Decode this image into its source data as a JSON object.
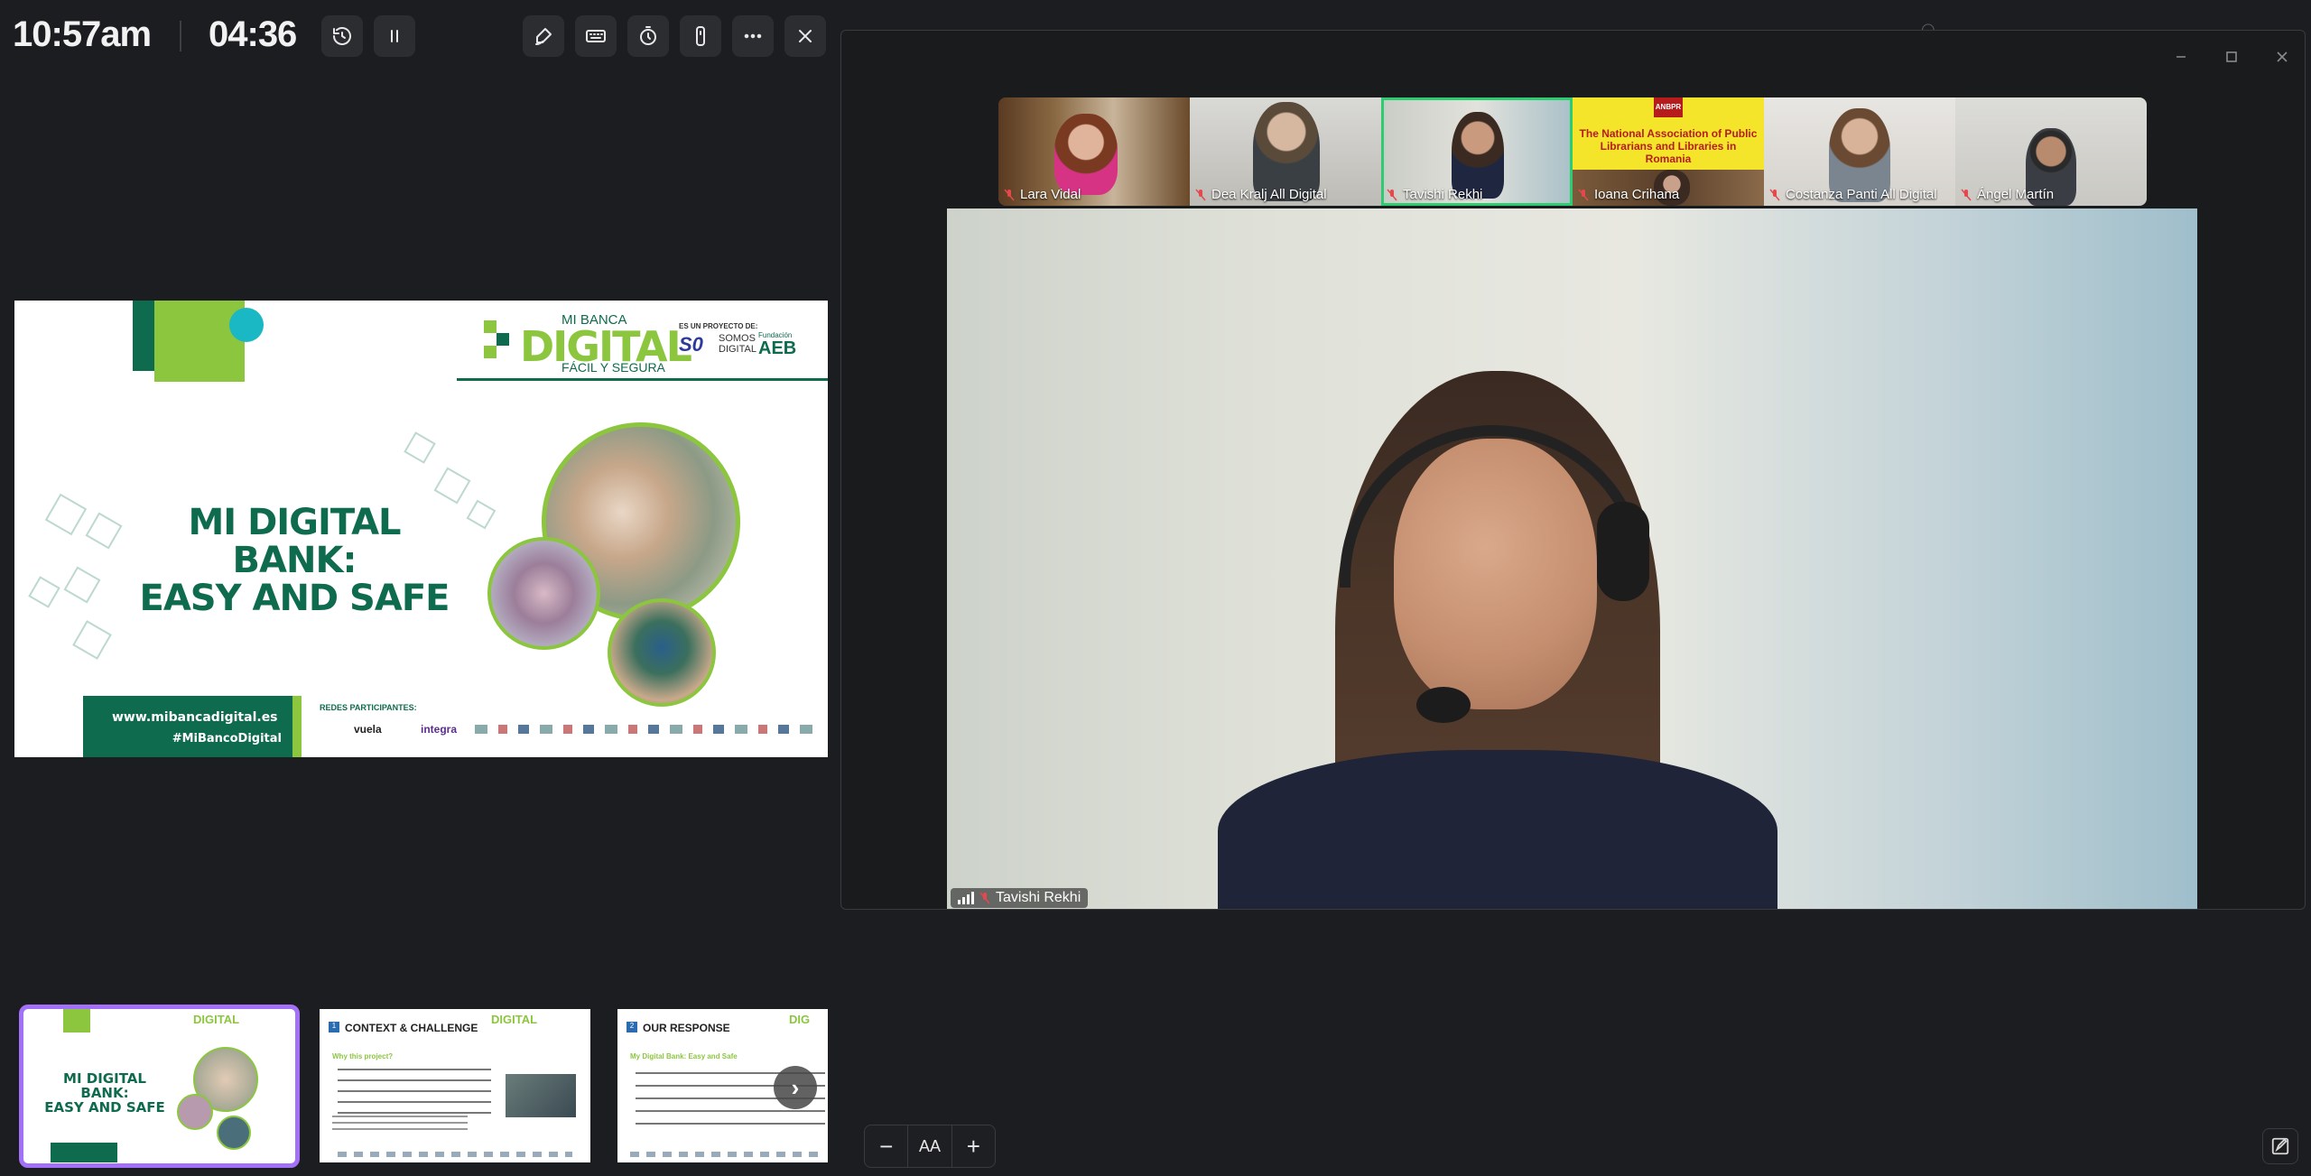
{
  "toolbar": {
    "current_time": "10:57am",
    "elapsed_time": "04:36",
    "buttons": [
      {
        "name": "restart-timer",
        "icon": "history-icon"
      },
      {
        "name": "pause",
        "icon": "pause-icon"
      },
      {
        "name": "pen",
        "icon": "pen-icon"
      },
      {
        "name": "keyboard",
        "icon": "keyboard-icon"
      },
      {
        "name": "timer",
        "icon": "stopwatch-icon"
      },
      {
        "name": "laser-pointer",
        "icon": "pointer-icon"
      },
      {
        "name": "more",
        "icon": "more-icon"
      },
      {
        "name": "close",
        "icon": "close-icon"
      }
    ]
  },
  "slide": {
    "brand_small": "MI BANCA",
    "brand_big": "DIGITAL",
    "brand_sub": "FÁCIL Y SEGURA",
    "project_label": "ES UN PROYECTO DE:",
    "partner1": "SOMOS DIGITAL",
    "partner2_small": "Fundación",
    "partner2": "AEB",
    "title_line1": "MI DIGITAL BANK:",
    "title_line2": "EASY AND SAFE",
    "url": "www.mibancadigital.es",
    "hashtag": "#MiBancoDigital",
    "networks_label": "REDES PARTICIPANTES:",
    "logos": [
      "vuela",
      "integra"
    ]
  },
  "thumbnails": [
    {
      "title_line1": "MI DIGITAL BANK:",
      "title_line2": "EASY AND SAFE"
    },
    {
      "number": "1",
      "title": "CONTEXT & CHALLENGE",
      "subtitle": "Why this project?"
    },
    {
      "number": "2",
      "title": "OUR RESPONSE",
      "subtitle": "My Digital Bank: Easy and Safe"
    }
  ],
  "participants": [
    {
      "name": "Lara Vidal"
    },
    {
      "name": "Dea Kralj All Digital"
    },
    {
      "name": "Tavishi Rekhi"
    },
    {
      "name": "Ioana Crihana"
    },
    {
      "name": "Costanza Panti All Digital"
    },
    {
      "name": "Ángel Martín"
    }
  ],
  "anbpr_banner": {
    "logo": "ANBPR",
    "text": "The National Association of Public Librarians and Libraries in Romania"
  },
  "speaker": {
    "name": "Tavishi Rekhi"
  },
  "controls": {
    "zoom_out": "−",
    "text_size": "AA",
    "zoom_in": "+"
  },
  "colors": {
    "accent": "#a371f7",
    "active_speaker": "#2ecc71",
    "brand_green": "#0f6b4e",
    "lime": "#8cc63f",
    "muted_mic": "#e5484d"
  }
}
